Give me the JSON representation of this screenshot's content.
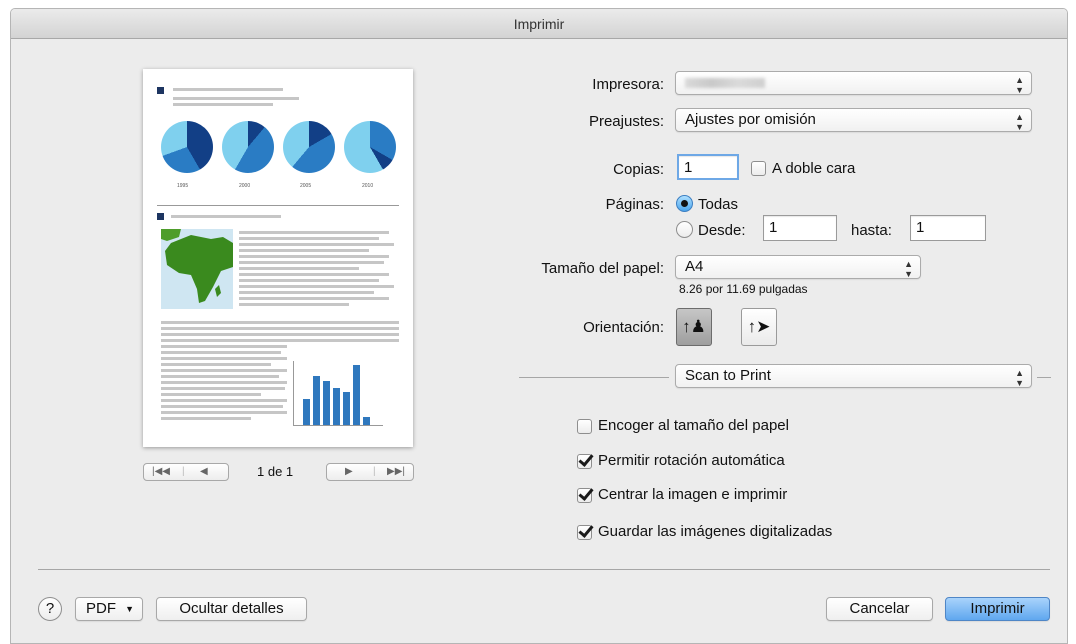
{
  "window": {
    "title": "Imprimir"
  },
  "printer": {
    "label": "Impresora:",
    "value": ""
  },
  "presets": {
    "label": "Preajustes:",
    "value": "Ajustes por omisión"
  },
  "copies": {
    "label": "Copias:",
    "value": "1",
    "duplex_label": "A doble cara",
    "duplex_checked": false
  },
  "pages": {
    "label": "Páginas:",
    "all_label": "Todas",
    "from_label": "Desde:",
    "from_value": "1",
    "to_label": "hasta:",
    "to_value": "1",
    "selected": "all"
  },
  "paper": {
    "label": "Tamaño del papel:",
    "value": "A4",
    "dimensions": "8.26 por 11.69 pulgadas"
  },
  "orientation": {
    "label": "Orientación:",
    "options": [
      "portrait-icon",
      "landscape-icon"
    ],
    "selected": "portrait"
  },
  "section_popup": {
    "value": "Scan to Print"
  },
  "options": [
    {
      "label": "Encoger al tamaño del papel",
      "checked": false
    },
    {
      "label": "Permitir rotación automática",
      "checked": true
    },
    {
      "label": "Centrar la imagen e imprimir",
      "checked": true
    },
    {
      "label": "Guardar las imágenes digitalizadas",
      "checked": true
    }
  ],
  "preview": {
    "page_indicator": "1 de 1",
    "pie_years": [
      "1995",
      "2000",
      "2005",
      "2010"
    ],
    "bar_values": [
      20,
      38,
      34,
      29,
      26,
      47,
      6
    ]
  },
  "footer": {
    "help_label": "?",
    "pdf_label": "PDF",
    "hide_details_label": "Ocultar detalles",
    "cancel_label": "Cancelar",
    "print_label": "Imprimir"
  },
  "colors": {
    "accent": "#5fa7ef",
    "pie_dark": "#123f86",
    "pie_mid": "#2a7cc4",
    "pie_light": "#7fd0ee",
    "bar": "#2f78be",
    "map_land": "#3a8a1e",
    "map_sea": "#cfe6f2"
  }
}
